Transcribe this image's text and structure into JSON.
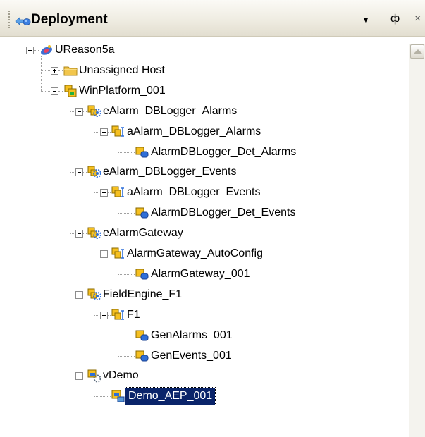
{
  "header": {
    "title": "Deployment",
    "dropdown_glyph": "▼",
    "pin_glyph": "ф",
    "close_glyph": "×"
  },
  "tree": {
    "nodes": [
      {
        "label": "UReason5a",
        "icon": "galaxy-icon",
        "expander": "expanded"
      },
      {
        "label": "Unassigned Host",
        "icon": "folder-icon",
        "expander": "collapsed"
      },
      {
        "label": "WinPlatform_001",
        "icon": "platform-icon",
        "expander": "expanded"
      },
      {
        "label": "eAlarm_DBLogger_Alarms",
        "icon": "engine-icon",
        "expander": "expanded"
      },
      {
        "label": "aAlarm_DBLogger_Alarms",
        "icon": "area-icon",
        "expander": "expanded"
      },
      {
        "label": "AlarmDBLogger_Det_Alarms",
        "icon": "object-icon",
        "expander": "none"
      },
      {
        "label": "eAlarm_DBLogger_Events",
        "icon": "engine-icon",
        "expander": "expanded"
      },
      {
        "label": "aAlarm_DBLogger_Events",
        "icon": "area-icon",
        "expander": "expanded"
      },
      {
        "label": "AlarmDBLogger_Det_Events",
        "icon": "object-icon",
        "expander": "none"
      },
      {
        "label": "eAlarmGateway",
        "icon": "engine-icon",
        "expander": "expanded"
      },
      {
        "label": "AlarmGateway_AutoConfig",
        "icon": "area-icon",
        "expander": "expanded"
      },
      {
        "label": "AlarmGateway_001",
        "icon": "object-icon",
        "expander": "none"
      },
      {
        "label": "FieldEngine_F1",
        "icon": "engine-icon",
        "expander": "expanded"
      },
      {
        "label": "F1",
        "icon": "area-icon",
        "expander": "expanded"
      },
      {
        "label": "GenAlarms_001",
        "icon": "object-icon",
        "expander": "none"
      },
      {
        "label": "GenEvents_001",
        "icon": "object-icon",
        "expander": "none"
      },
      {
        "label": "vDemo",
        "icon": "view-engine-icon",
        "expander": "expanded"
      },
      {
        "label": "Demo_AEP_001",
        "icon": "view-app-icon",
        "expander": "none",
        "selected": true
      }
    ]
  },
  "colors": {
    "selection": "#0a246a",
    "icon_yellow": "#f6c020",
    "icon_blue": "#2f6fd8",
    "folder": "#f2c64c",
    "galaxy": "#3d6fd1"
  }
}
